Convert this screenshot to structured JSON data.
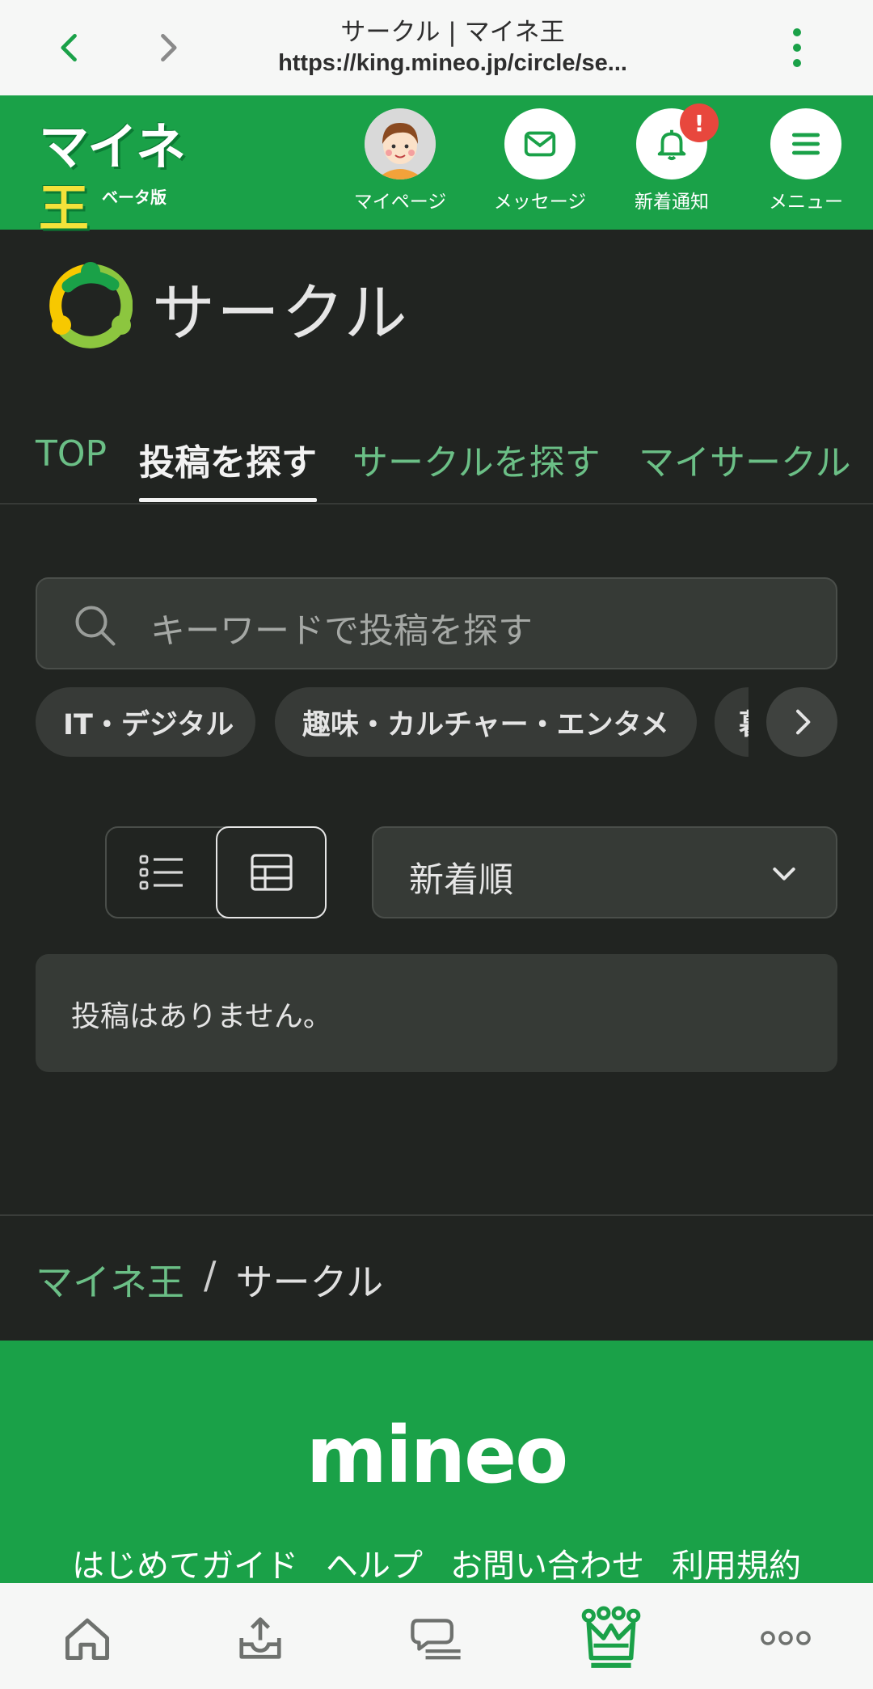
{
  "browser": {
    "page_title": "サークル | マイネ王",
    "url": "https://king.mineo.jp/circle/se..."
  },
  "header": {
    "logo_text": "マイネ王",
    "logo_subtitle": "ベータ版",
    "items": [
      {
        "label": "マイページ",
        "icon": "avatar"
      },
      {
        "label": "メッセージ",
        "icon": "mail-icon"
      },
      {
        "label": "新着通知",
        "icon": "bell-icon",
        "badge": "!"
      },
      {
        "label": "メニュー",
        "icon": "hamburger-icon"
      }
    ]
  },
  "page": {
    "title": "サークル"
  },
  "tabs": [
    {
      "label": "TOP",
      "active": false
    },
    {
      "label": "投稿を探す",
      "active": true
    },
    {
      "label": "サークルを探す",
      "active": false
    },
    {
      "label": "マイサークル",
      "active": false
    }
  ],
  "search": {
    "placeholder": "キーワードで投稿を探す"
  },
  "chips": [
    "IT・デジタル",
    "趣味・カルチャー・エンタメ",
    "暮"
  ],
  "sort": {
    "selected": "新着順"
  },
  "view_mode": "grid",
  "empty_message": "投稿はありません。",
  "breadcrumb": {
    "root": "マイネ王",
    "separator": "/",
    "current": "サークル"
  },
  "footer": {
    "brand": "mineo",
    "links": [
      "はじめてガイド",
      "ヘルプ",
      "お問い合わせ",
      "利用規約"
    ]
  },
  "bottom_nav": [
    "home-icon",
    "upload-icon",
    "chat-icon",
    "crown-icon",
    "more-icon"
  ],
  "colors": {
    "brand_green": "#1aa148",
    "link_green": "#6bbf86",
    "background": "#212421",
    "badge_red": "#e8473d"
  }
}
